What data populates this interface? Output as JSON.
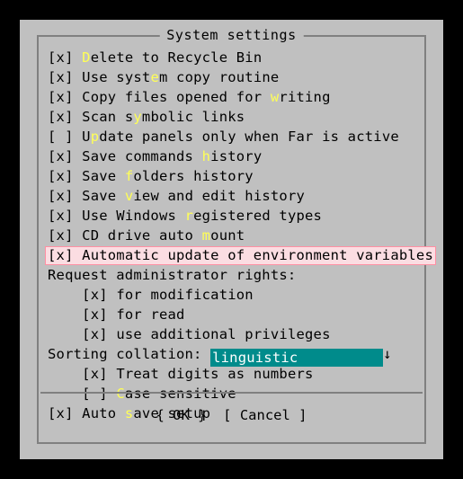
{
  "window": {
    "title": "System settings"
  },
  "options": [
    {
      "prefix": "[",
      "state": "x",
      "suffix": "] ",
      "pre": "",
      "hot": "D",
      "post": "elete to Recycle Bin",
      "indent": 0,
      "highlight": false
    },
    {
      "prefix": "[",
      "state": "x",
      "suffix": "] ",
      "pre": "Use syst",
      "hot": "e",
      "post": "m copy routine",
      "indent": 0,
      "highlight": false
    },
    {
      "prefix": "[",
      "state": "x",
      "suffix": "] ",
      "pre": "Copy files opened for ",
      "hot": "w",
      "post": "riting",
      "indent": 0,
      "highlight": false
    },
    {
      "prefix": "[",
      "state": "x",
      "suffix": "] ",
      "pre": "Scan s",
      "hot": "y",
      "post": "mbolic links",
      "indent": 0,
      "highlight": false
    },
    {
      "prefix": "[",
      "state": " ",
      "suffix": "] ",
      "pre": "U",
      "hot": "p",
      "post": "date panels only when Far is active",
      "indent": 0,
      "highlight": false
    },
    {
      "prefix": "[",
      "state": "x",
      "suffix": "] ",
      "pre": "Save commands ",
      "hot": "h",
      "post": "istory",
      "indent": 0,
      "highlight": false
    },
    {
      "prefix": "[",
      "state": "x",
      "suffix": "] ",
      "pre": "Save ",
      "hot": "f",
      "post": "olders history",
      "indent": 0,
      "highlight": false
    },
    {
      "prefix": "[",
      "state": "x",
      "suffix": "] ",
      "pre": "Save ",
      "hot": "v",
      "post": "iew and edit history",
      "indent": 0,
      "highlight": false
    },
    {
      "prefix": "[",
      "state": "x",
      "suffix": "] ",
      "pre": "Use Windows ",
      "hot": "r",
      "post": "egistered types",
      "indent": 0,
      "highlight": false
    },
    {
      "prefix": "[",
      "state": "x",
      "suffix": "] ",
      "pre": "CD drive auto ",
      "hot": "m",
      "post": "ount",
      "indent": 0,
      "highlight": false
    },
    {
      "prefix": "[",
      "state": "x",
      "suffix": "] ",
      "pre": "Automatic update of environment variables",
      "hot": "",
      "post": "",
      "indent": 0,
      "highlight": true
    }
  ],
  "admin_label": "Request administrator rights:",
  "admin_options": [
    {
      "prefix": "[",
      "state": "x",
      "suffix": "] ",
      "pre": "for modification",
      "hot": "",
      "post": "",
      "indent": 4
    },
    {
      "prefix": "[",
      "state": "x",
      "suffix": "] ",
      "pre": "for read",
      "hot": "",
      "post": "",
      "indent": 4
    },
    {
      "prefix": "[",
      "state": "x",
      "suffix": "] ",
      "pre": "use additional privileges",
      "hot": "",
      "post": "",
      "indent": 4
    }
  ],
  "sorting": {
    "label": "Sorting collation: ",
    "value": "linguistic",
    "arrow": "↓"
  },
  "sorting_options": [
    {
      "prefix": "[",
      "state": "x",
      "suffix": "] ",
      "pre": "Treat digits as numbers",
      "hot": "",
      "post": "",
      "indent": 4
    },
    {
      "prefix": "[",
      "state": " ",
      "suffix": "] ",
      "pre": "",
      "hot": "C",
      "post": "ase sensitive",
      "indent": 4
    }
  ],
  "auto_save": {
    "prefix": "[",
    "state": "x",
    "suffix": "] ",
    "pre": "Auto ",
    "hot": "s",
    "post": "ave setup",
    "indent": 0
  },
  "buttons": {
    "ok": "{ OK }",
    "gap": "  ",
    "cancel": "[ Cancel ]"
  },
  "colors": {
    "dialog_bg": "#c0c0c0",
    "hotkey": "#ffff55",
    "combo_bg": "#008b8b",
    "combo_fg": "#ffffff",
    "highlight_border": "#ff8fa3",
    "highlight_bg": "#fbdde2",
    "screen_bg": "#000000"
  }
}
